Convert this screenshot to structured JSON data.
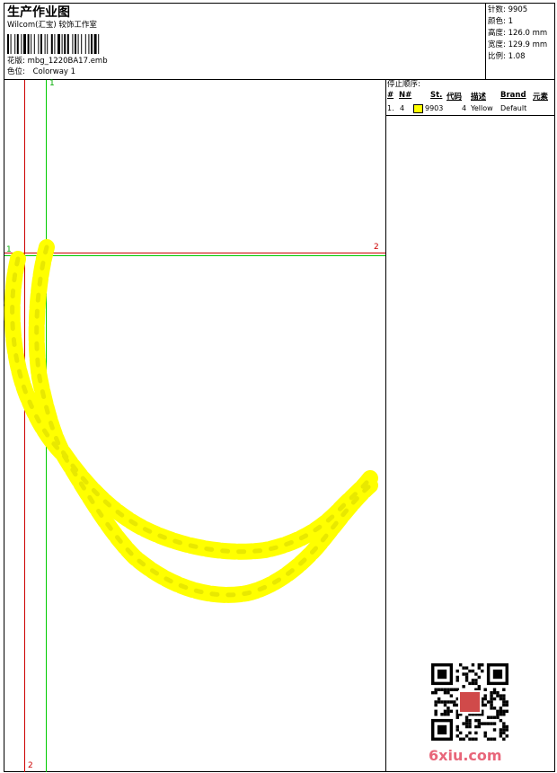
{
  "header": {
    "title": "生产作业图",
    "subtitle": "Wilcom(汇宝) 较饰工作室",
    "design_label": "花版:",
    "design_file": "mbg_1220BA17.emb",
    "colorway_label": "色位:",
    "colorway": "Colorway 1"
  },
  "stats": {
    "stitches_label": "针数:",
    "stitches": "9905",
    "colors_label": "颜色:",
    "colors": "1",
    "height_label": "高度:",
    "height": "126.0 mm",
    "width_label": "宽度:",
    "width": "129.9 mm",
    "ratio_label": "比例:",
    "ratio": "1.08"
  },
  "markers": {
    "v1_top": "1",
    "v2_bottom": "2",
    "h1_left": "1",
    "h2_right": "2"
  },
  "stop_sequence": {
    "title": "停止顺序:",
    "columns": [
      "#",
      "N#",
      "St.",
      "代码",
      "描述",
      "Brand",
      "元素"
    ],
    "rows": [
      {
        "index": "1.",
        "needle": "4",
        "stitches": "9903",
        "code": "4",
        "description": "Yellow",
        "brand": "Default",
        "swatch_color": "#ffff00"
      }
    ]
  },
  "watermark": {
    "site": "6xiu.com"
  },
  "colors": {
    "thread": "#ffff00",
    "thread_outline": "#d6d600",
    "red_guide": "#cc0000",
    "green_guide": "#00cc00"
  }
}
